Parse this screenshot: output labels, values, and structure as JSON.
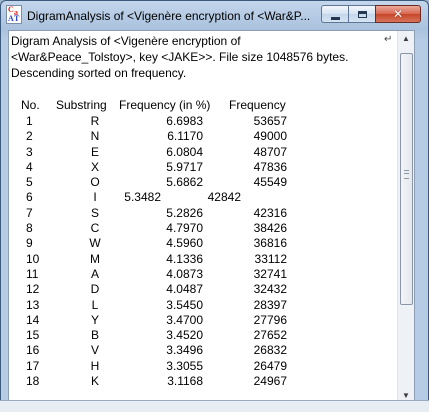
{
  "window": {
    "title": "DigramAnalysis of <Vigenère encryption of <War&P...",
    "icon_letters": [
      "C",
      "a",
      "A",
      "T"
    ]
  },
  "caption_buttons": {
    "close_glyph": "✕"
  },
  "description": {
    "line1": "Digram Analysis of <Vigenère encryption of",
    "line2": "<War&Peace_Tolstoy>, key <JAKE>>. File size 1048576 bytes.",
    "line3": "Descending sorted on frequency."
  },
  "table": {
    "headers": {
      "no": "No.",
      "substring": "Substring",
      "freq_pct": "Frequency (in %)",
      "freq": "Frequency"
    },
    "rows": [
      {
        "no": "1",
        "sub": "R",
        "pct": "6.6983",
        "freq": "53657"
      },
      {
        "no": "2",
        "sub": "N",
        "pct": "6.1170",
        "freq": "49000"
      },
      {
        "no": "3",
        "sub": "E",
        "pct": "6.0804",
        "freq": "48707"
      },
      {
        "no": "4",
        "sub": "X",
        "pct": "5.9717",
        "freq": "47836"
      },
      {
        "no": "5",
        "sub": "O",
        "pct": "5.6862",
        "freq": "45549"
      },
      {
        "no": "6",
        "sub": "I",
        "pct": "5.3482",
        "freq": "42842"
      },
      {
        "no": "7",
        "sub": "S",
        "pct": "5.2826",
        "freq": "42316"
      },
      {
        "no": "8",
        "sub": "C",
        "pct": "4.7970",
        "freq": "38426"
      },
      {
        "no": "9",
        "sub": "W",
        "pct": "4.5960",
        "freq": "36816"
      },
      {
        "no": "10",
        "sub": "M",
        "pct": "4.1336",
        "freq": "33112"
      },
      {
        "no": "11",
        "sub": "A",
        "pct": "4.0873",
        "freq": "32741"
      },
      {
        "no": "12",
        "sub": "D",
        "pct": "4.0487",
        "freq": "32432"
      },
      {
        "no": "13",
        "sub": "L",
        "pct": "3.5450",
        "freq": "28397"
      },
      {
        "no": "14",
        "sub": "Y",
        "pct": "3.4700",
        "freq": "27796"
      },
      {
        "no": "15",
        "sub": "B",
        "pct": "3.4520",
        "freq": "27652"
      },
      {
        "no": "16",
        "sub": "V",
        "pct": "3.3496",
        "freq": "26832"
      },
      {
        "no": "17",
        "sub": "H",
        "pct": "3.3055",
        "freq": "26479"
      },
      {
        "no": "18",
        "sub": "K",
        "pct": "3.1168",
        "freq": "24967"
      }
    ]
  },
  "scrollbar": {
    "up_arrow": "▲",
    "down_arrow": "▼",
    "wrap_glyph": "↵"
  }
}
